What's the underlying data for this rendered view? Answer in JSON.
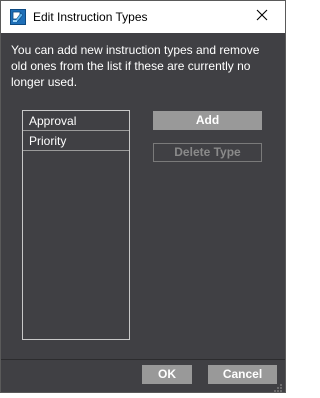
{
  "window": {
    "title": "Edit Instruction Types",
    "icons": {
      "app": "app-dialog-icon",
      "close": "close-icon",
      "resize": "resize-grip-icon"
    }
  },
  "dialog": {
    "description": "You can add new instruction types and remove old ones from the list if these are currently no longer used.",
    "types": [
      {
        "label": "Approval"
      },
      {
        "label": "Priority"
      }
    ],
    "add_label": "Add",
    "delete_label": "Delete Type"
  },
  "footer": {
    "ok_label": "OK",
    "cancel_label": "Cancel"
  },
  "colors": {
    "background": "#404044",
    "button": "#999999",
    "button_disabled_text": "#8a8a8a",
    "text": "#ffffff"
  }
}
